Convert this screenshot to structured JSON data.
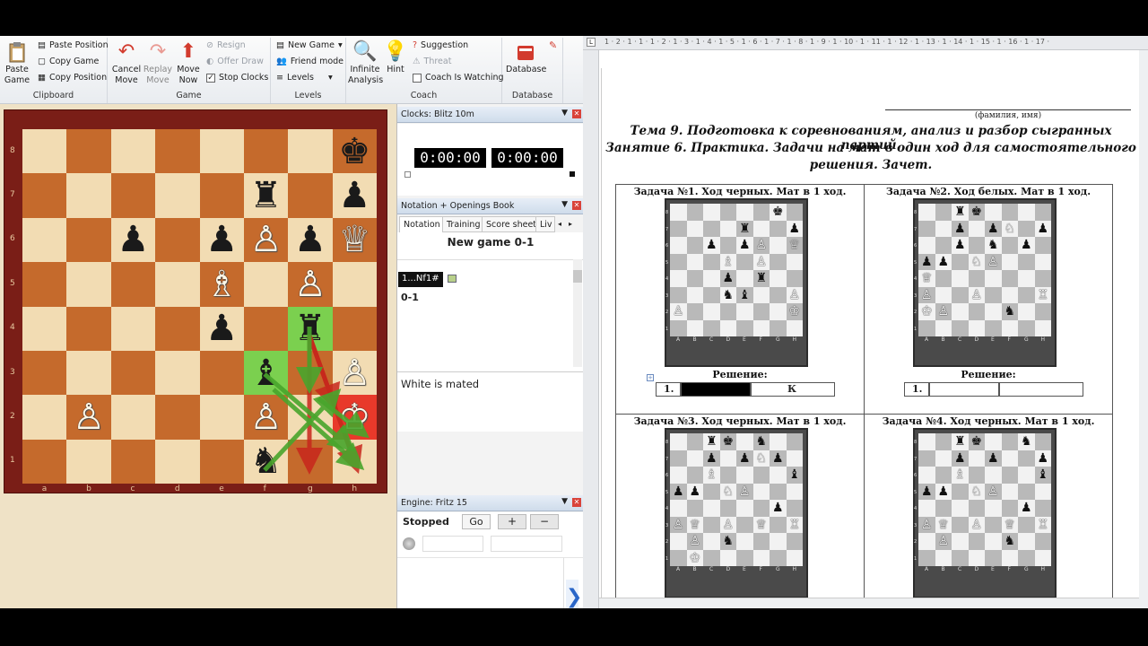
{
  "ribbon": {
    "clipboard": {
      "paste_game": "Paste\nGame",
      "paste_position": "Paste Position",
      "copy_game": "Copy Game",
      "copy_position": "Copy Position",
      "label": "Clipboard"
    },
    "game": {
      "cancel_move": "Cancel\nMove",
      "replay_move": "Replay\nMove",
      "move_now": "Move\nNow",
      "resign": "Resign",
      "offer_draw": "Offer Draw",
      "stop_clocks": "Stop Clocks",
      "label": "Game"
    },
    "levels": {
      "new_game": "New Game",
      "friend_mode": "Friend mode",
      "levels": "Levels",
      "label": "Levels"
    },
    "coach": {
      "infinite_analysis": "Infinite\nAnalysis",
      "hint": "Hint",
      "suggestion": "Suggestion",
      "threat": "Threat",
      "coach_watching": "Coach Is Watching",
      "label": "Coach"
    },
    "database": {
      "database": "Database",
      "label": "Database"
    }
  },
  "board": {
    "files": [
      "a",
      "b",
      "c",
      "d",
      "e",
      "f",
      "g",
      "h"
    ],
    "ranks": [
      "8",
      "7",
      "6",
      "5",
      "4",
      "3",
      "2",
      "1"
    ],
    "pieces": [
      {
        "sq": "h8",
        "p": "♚",
        "c": "b"
      },
      {
        "sq": "f7",
        "p": "♜",
        "c": "b"
      },
      {
        "sq": "h7",
        "p": "♟",
        "c": "b"
      },
      {
        "sq": "c6",
        "p": "♟",
        "c": "b"
      },
      {
        "sq": "e6",
        "p": "♟",
        "c": "b"
      },
      {
        "sq": "f6",
        "p": "♙",
        "c": "w"
      },
      {
        "sq": "g6",
        "p": "♟",
        "c": "b"
      },
      {
        "sq": "h6",
        "p": "♕",
        "c": "w"
      },
      {
        "sq": "e5",
        "p": "♗",
        "c": "w"
      },
      {
        "sq": "g5",
        "p": "♙",
        "c": "w"
      },
      {
        "sq": "e4",
        "p": "♟",
        "c": "b"
      },
      {
        "sq": "g4",
        "p": "♜",
        "c": "b"
      },
      {
        "sq": "f3",
        "p": "♝",
        "c": "b"
      },
      {
        "sq": "h3",
        "p": "♙",
        "c": "w"
      },
      {
        "sq": "b2",
        "p": "♙",
        "c": "w"
      },
      {
        "sq": "f2",
        "p": "♙",
        "c": "w"
      },
      {
        "sq": "h2",
        "p": "♔",
        "c": "w"
      },
      {
        "sq": "f1",
        "p": "♞",
        "c": "b"
      }
    ],
    "highlights": [
      {
        "sq": "g4",
        "t": "hl"
      },
      {
        "sq": "f3",
        "t": "hl"
      },
      {
        "sq": "h2",
        "t": "hlr"
      }
    ]
  },
  "clocks": {
    "title": "Clocks: Blitz 10m",
    "white": "0:00:00",
    "black": "0:00:00"
  },
  "notation": {
    "title": "Notation + Openings Book",
    "tabs": [
      "Notation",
      "Training",
      "Score sheet",
      "Liv"
    ],
    "header": "New game  0-1",
    "move": "1...Nf1#",
    "result": "0-1",
    "comment": "White is mated"
  },
  "engine": {
    "title": "Engine: Fritz 15",
    "stopped": "Stopped",
    "go": "Go",
    "plus": "+",
    "minus": "−"
  },
  "document": {
    "name_caption": "(фамилия, имя)",
    "title_lines": [
      "Тема 9. Подготовка к соревнованиям, анализ и разбор сыгранных партий.",
      "Занятие 6. Практика. Задачи на мат в один ход для самостоятельного",
      "решения. Зачет."
    ],
    "tasks": [
      {
        "label": "Задача №1. Ход черных. Мат в 1 ход.",
        "solution": "Решение:",
        "answer_num": "1.",
        "answer_text": "К"
      },
      {
        "label": "Задача №2. Ход белых. Мат в 1 ход.",
        "solution": "Решение:",
        "answer_num": "1.",
        "answer_text": ""
      },
      {
        "label": "Задача №3. Ход черных. Мат в 1 ход."
      },
      {
        "label": "Задача №4. Ход черных. Мат в 1 ход."
      }
    ],
    "ruler": "1 · 2 · 1 · 1 · 1 · 2 · 1 · 3 · 1 · 4 · 1 · 5 · 1 · 6 · 1 · 7 · 1 · 8 · 1 · 9 · 1 · 10 · 1 · 11 · 1 · 12 · 1 · 13 · 1 · 14 · 1 · 15 · 1 · 16 · 1 · 17 ·"
  },
  "minis": [
    {
      "rows": [
        "......♚.",
        "....♜..♟",
        "..♟.♟♙.♕",
        "...♗.♙..",
        "...♟.♜..",
        "...♞♝..♙",
        "♙......♔",
        "........"
      ]
    },
    {
      "rows": [
        "..♜♚....",
        "..♟.♟♘.♟",
        "..♟.♞.♟.",
        "♟♟.♘♙...",
        "♕.......",
        "♙..♙...♖",
        "♔♙...♞..",
        "........"
      ]
    },
    {
      "rows": [
        "..♜♚.♞..",
        "..♟.♟♘♟.",
        "..♗....♝",
        "♟♟.♘♙...",
        "......♟.",
        "♙♕.♙.♕.♖",
        ".♙.♞....",
        ".♔......"
      ]
    },
    {
      "rows": [
        "..♜♚..♞.",
        "..♟.♟..♟",
        "..♗....♝",
        "♟♟.♘♙...",
        "......♟.",
        "♙♕.♙.♕.♖",
        ".♙...♞..",
        "........"
      ]
    }
  ]
}
